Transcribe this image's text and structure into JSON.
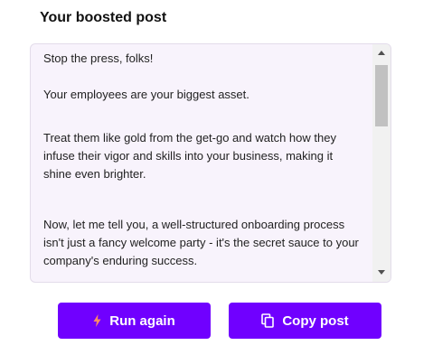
{
  "header": {
    "title": "Your boosted post"
  },
  "post": {
    "paragraphs": [
      "Stop the press, folks!",
      "Your employees are your biggest asset.",
      "Treat them like gold from the get-go and watch how they infuse their vigor and skills into your business, making it shine even brighter.",
      "Now, let me tell you, a well-structured onboarding process isn't just a fancy welcome party - it's the secret sauce to your company's enduring success."
    ]
  },
  "actions": {
    "run_again_label": "Run again",
    "copy_post_label": "Copy post"
  },
  "icons": {
    "run_again": "lightning-icon",
    "copy_post": "copy-icon"
  },
  "colors": {
    "accent": "#7000ff",
    "lightning": "#ff8a65",
    "post_background": "#f8f3fc"
  }
}
